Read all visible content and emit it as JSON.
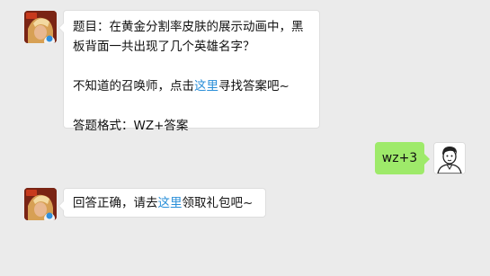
{
  "messages": [
    {
      "q_prefix": "题目：在黄金分割率皮肤的展示动画中，黑",
      "q_suffix": "板背面一共出现了几个英雄名字？",
      "help_before": "不知道的召唤师，点击",
      "help_link": "这里",
      "help_after": "寻找答案吧~",
      "format_text": "答题格式：WZ+答案"
    },
    {
      "reply_text": "wz+3"
    },
    {
      "result_before": "回答正确，请去",
      "result_link": "这里",
      "result_after": "领取礼包吧~"
    }
  ],
  "colors": {
    "background": "#ebebeb",
    "green_bubble": "#9eea6a",
    "link": "#2a8fd8"
  }
}
